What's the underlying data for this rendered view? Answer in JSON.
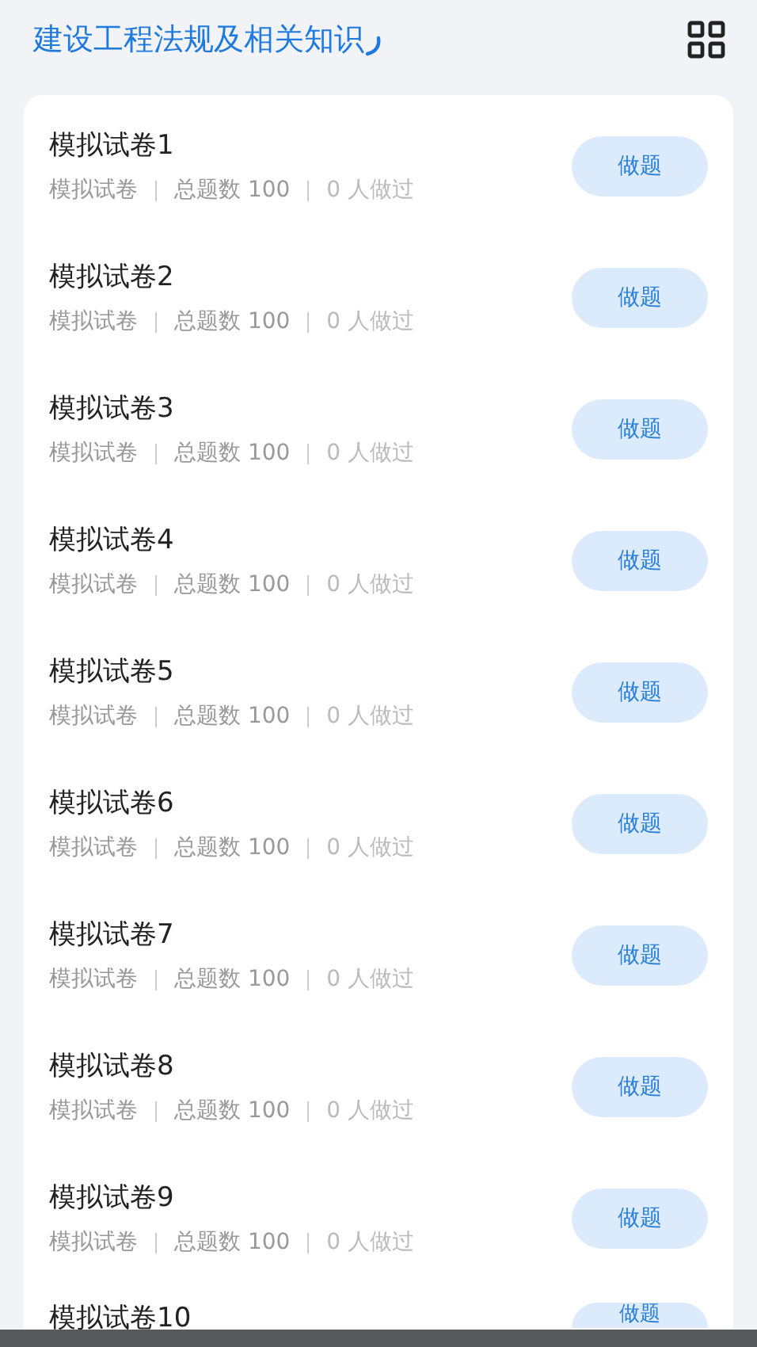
{
  "header": {
    "title": "建设工程法规及相关知识"
  },
  "papers": [
    {
      "title": "模拟试卷1",
      "type": "模拟试卷",
      "total": "总题数 100",
      "done": "0 人做过",
      "button": "做题"
    },
    {
      "title": "模拟试卷2",
      "type": "模拟试卷",
      "total": "总题数 100",
      "done": "0 人做过",
      "button": "做题"
    },
    {
      "title": "模拟试卷3",
      "type": "模拟试卷",
      "total": "总题数 100",
      "done": "0 人做过",
      "button": "做题"
    },
    {
      "title": "模拟试卷4",
      "type": "模拟试卷",
      "total": "总题数 100",
      "done": "0 人做过",
      "button": "做题"
    },
    {
      "title": "模拟试卷5",
      "type": "模拟试卷",
      "total": "总题数 100",
      "done": "0 人做过",
      "button": "做题"
    },
    {
      "title": "模拟试卷6",
      "type": "模拟试卷",
      "total": "总题数 100",
      "done": "0 人做过",
      "button": "做题"
    },
    {
      "title": "模拟试卷7",
      "type": "模拟试卷",
      "total": "总题数 100",
      "done": "0 人做过",
      "button": "做题"
    },
    {
      "title": "模拟试卷8",
      "type": "模拟试卷",
      "total": "总题数 100",
      "done": "0 人做过",
      "button": "做题"
    },
    {
      "title": "模拟试卷9",
      "type": "模拟试卷",
      "total": "总题数 100",
      "done": "0 人做过",
      "button": "做题"
    },
    {
      "title": "模拟试卷10",
      "button": "做题"
    }
  ]
}
